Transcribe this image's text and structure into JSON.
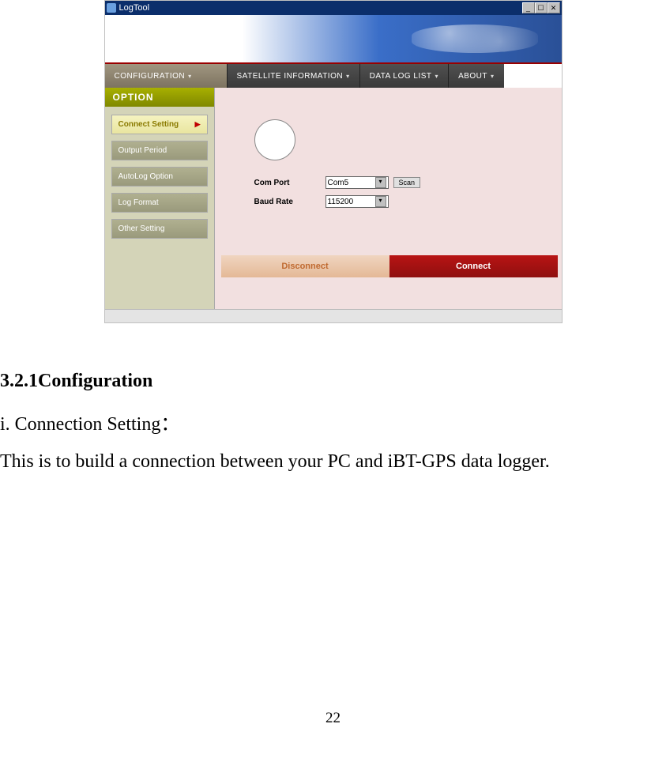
{
  "window": {
    "title": "LogTool"
  },
  "tabs": [
    {
      "label": "CONFIGURATION"
    },
    {
      "label": "SATELLITE  INFORMATION"
    },
    {
      "label": "DATA  LOG  LIST"
    },
    {
      "label": "ABOUT"
    }
  ],
  "sidebar": {
    "heading": "OPTION",
    "items": [
      {
        "label": "Connect  Setting",
        "active": true
      },
      {
        "label": "Output  Period",
        "active": false
      },
      {
        "label": "AutoLog  Option",
        "active": false
      },
      {
        "label": "Log  Format",
        "active": false
      },
      {
        "label": "Other  Setting",
        "active": false
      }
    ]
  },
  "form": {
    "comport_label": "Com Port",
    "comport_value": "Com5",
    "baud_label": "Baud Rate",
    "baud_value": "115200",
    "scan_label": "Scan"
  },
  "buttons": {
    "disconnect": "Disconnect",
    "connect": "Connect"
  },
  "doc": {
    "section_heading": "3.2.1Configuration",
    "sub_heading": "i. Connection Setting：",
    "body": "This is to build a connection between your PC and iBT-GPS data logger.",
    "page_number": "22"
  }
}
